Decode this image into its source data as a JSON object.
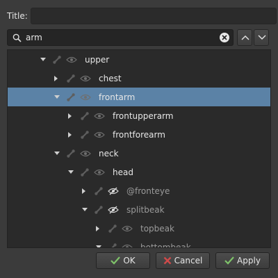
{
  "title": {
    "label": "Title:",
    "value": ""
  },
  "search": {
    "query": "arm"
  },
  "tree": {
    "rows": [
      {
        "label": "upper",
        "depth": 0,
        "expanded": true,
        "selected": false,
        "eye_style": "hidden",
        "label_style": "normal"
      },
      {
        "label": "chest",
        "depth": 1,
        "expanded": false,
        "selected": false,
        "eye_style": "hidden",
        "label_style": "normal"
      },
      {
        "label": "frontarm",
        "depth": 1,
        "expanded": true,
        "selected": true,
        "eye_style": "hidden",
        "label_style": "normal"
      },
      {
        "label": "frontupperarm",
        "depth": 2,
        "expanded": false,
        "selected": false,
        "eye_style": "hidden",
        "label_style": "normal"
      },
      {
        "label": "frontforearm",
        "depth": 2,
        "expanded": false,
        "selected": false,
        "eye_style": "hidden",
        "label_style": "normal"
      },
      {
        "label": "neck",
        "depth": 1,
        "expanded": true,
        "selected": false,
        "eye_style": "hidden",
        "label_style": "normal"
      },
      {
        "label": "head",
        "depth": 2,
        "expanded": true,
        "selected": false,
        "eye_style": "hidden",
        "label_style": "normal"
      },
      {
        "label": "@fronteye",
        "depth": 3,
        "expanded": false,
        "selected": false,
        "eye_style": "crossed",
        "label_style": "dim"
      },
      {
        "label": "splitbeak",
        "depth": 3,
        "expanded": true,
        "selected": false,
        "eye_style": "crossed",
        "label_style": "dim"
      },
      {
        "label": "topbeak",
        "depth": 4,
        "expanded": false,
        "selected": false,
        "eye_style": "hidden",
        "label_style": "dim"
      },
      {
        "label": "bottombeak",
        "depth": 4,
        "expanded": true,
        "selected": false,
        "eye_style": "hidden",
        "label_style": "dim"
      }
    ]
  },
  "buttons": {
    "ok": "OK",
    "cancel": "Cancel",
    "apply": "Apply"
  },
  "colors": {
    "selection": "#5b82a6",
    "ok_icon": "#7fc36a",
    "cancel_icon": "#d04a4a",
    "apply_icon": "#7fc36a"
  }
}
